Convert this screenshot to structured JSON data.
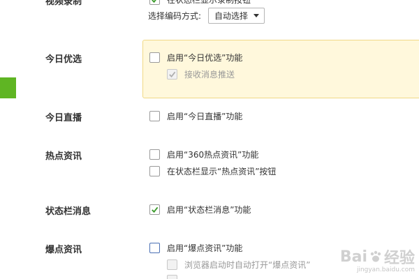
{
  "top": {
    "partial_label": "视频录制",
    "partial_option": "在状态栏显示录制按钮",
    "encoding_label": "选择编码方式:",
    "encoding_value": "自动选择"
  },
  "sections": {
    "today_pick": {
      "label": "今日优选",
      "enable": "启用“今日优选”功能",
      "sub_receive": "接收消息推送"
    },
    "today_live": {
      "label": "今日直播",
      "enable": "启用“今日直播”功能"
    },
    "hot_news": {
      "label": "热点资讯",
      "enable": "启用“360热点资讯”功能",
      "show_button": "在状态栏显示“热点资讯”按钮"
    },
    "status_msg": {
      "label": "状态栏消息",
      "enable": "启用“状态栏消息”功能"
    },
    "burst_news": {
      "label": "爆点资讯",
      "enable": "启用“爆点资讯”功能",
      "auto_open": "浏览器启动时自动打开“爆点资讯”"
    }
  },
  "watermark": {
    "brand_left": "Bai",
    "brand_right": "经验",
    "url": "jingyan.baidu.com"
  },
  "colors": {
    "accent_green": "#5fb523",
    "highlight_bg": "#fff8dc",
    "highlight_border": "#f0d985",
    "check_green": "#3a9a2a"
  }
}
